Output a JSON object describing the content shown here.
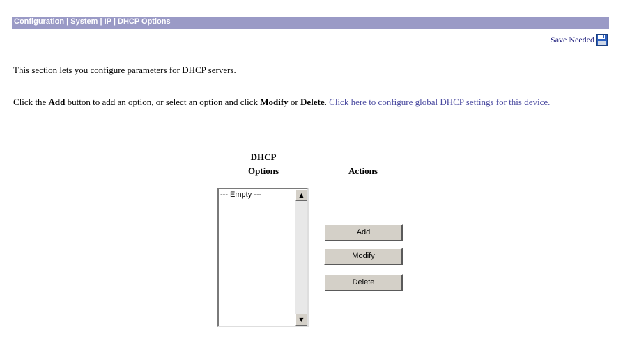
{
  "header": {
    "breadcrumb": "Configuration | System | IP | DHCP Options"
  },
  "save_needed": {
    "label": "Save Needed"
  },
  "intro": {
    "text": "This section lets you configure parameters for DHCP servers."
  },
  "instructions": {
    "part1": "Click the ",
    "add_word": "Add",
    "part2": " button to add an option, or select an option and click ",
    "modify_word": "Modify",
    "part3": " or ",
    "delete_word": "Delete",
    "part4": ". ",
    "link_text": "Click here to configure global DHCP settings for this device."
  },
  "options_column": {
    "header_line1": "DHCP",
    "header_line2": "Options",
    "items": [
      "--- Empty ---"
    ]
  },
  "actions_column": {
    "header": "Actions",
    "buttons": {
      "add": "Add",
      "modify": "Modify",
      "delete": "Delete"
    }
  },
  "colors": {
    "header_bar": "#9a9ac6",
    "link": "#4a4aa0",
    "button_face": "#d4d0c8"
  },
  "icons": {
    "save": "floppy-disk-icon",
    "scroll_up": "scroll-up-arrow-icon",
    "scroll_down": "scroll-down-arrow-icon"
  }
}
